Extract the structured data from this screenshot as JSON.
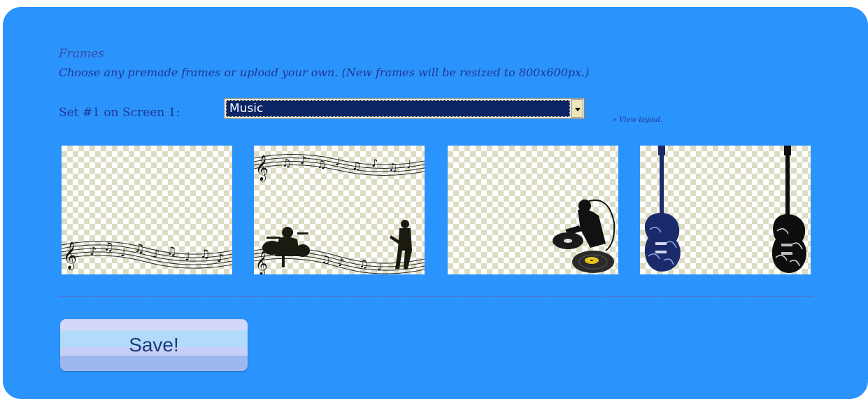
{
  "frames_section": {
    "title": "Frames",
    "description": "Choose any premade frames or upload your own. (New frames will be resized to 800x600px.)"
  },
  "set_selector": {
    "label": "Set #1 on Screen 1:",
    "selected_value": "Music"
  },
  "view_layout_link": "» View layout.",
  "frames": [
    {
      "icon": "music-staff-bottom-icon"
    },
    {
      "icon": "band-silhouette-icon"
    },
    {
      "icon": "dj-turntable-icon"
    },
    {
      "icon": "electric-guitars-icon"
    }
  ],
  "save_button": {
    "label": "Save!"
  },
  "colors": {
    "panel_background": "#2b94fc",
    "heading_text": "#1f3596",
    "select_highlight": "#0b2466"
  }
}
